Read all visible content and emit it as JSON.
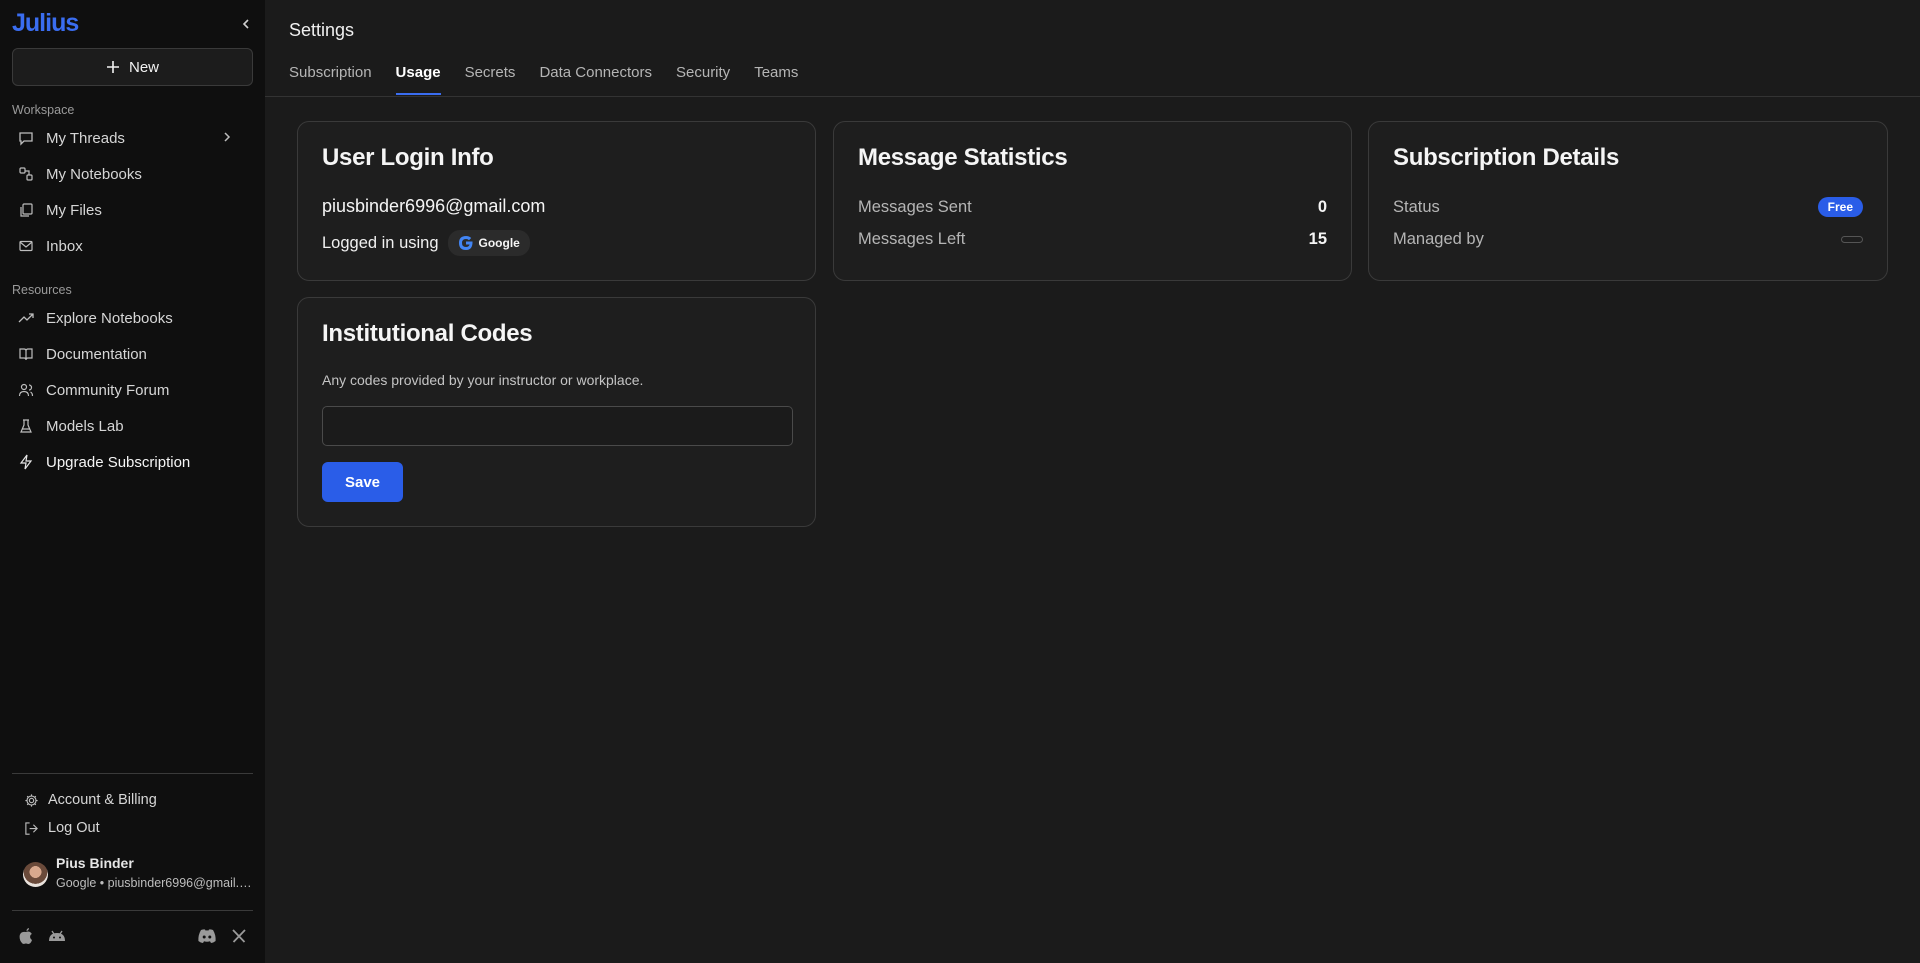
{
  "sidebar": {
    "logo": "Julius",
    "new_label": "New",
    "workspace_label": "Workspace",
    "workspace_items": [
      {
        "label": "My Threads",
        "icon": "chat-bubble-icon"
      },
      {
        "label": "My Notebooks",
        "icon": "notebook-nodes-icon"
      },
      {
        "label": "My Files",
        "icon": "files-icon"
      },
      {
        "label": "Inbox",
        "icon": "mail-icon"
      }
    ],
    "resources_label": "Resources",
    "resource_items": [
      {
        "label": "Explore Notebooks",
        "icon": "trending-icon"
      },
      {
        "label": "Documentation",
        "icon": "book-icon"
      },
      {
        "label": "Community Forum",
        "icon": "users-icon"
      },
      {
        "label": "Models Lab",
        "icon": "flask-icon"
      },
      {
        "label": "Upgrade Subscription",
        "icon": "lightning-icon"
      }
    ],
    "account_label": "Account & Billing",
    "logout_label": "Log Out",
    "user_name": "Pius Binder",
    "user_sub": "Google • piusbinder6996@gmail.com"
  },
  "main": {
    "title": "Settings",
    "tabs": [
      "Subscription",
      "Usage",
      "Secrets",
      "Data Connectors",
      "Security",
      "Teams"
    ],
    "active_tab": "Usage"
  },
  "login_card": {
    "title": "User Login Info",
    "email": "piusbinder6996@gmail.com",
    "logged_in_label": "Logged in using",
    "provider": "Google"
  },
  "stats_card": {
    "title": "Message Statistics",
    "sent_label": "Messages Sent",
    "sent_value": "0",
    "left_label": "Messages Left",
    "left_value": "15"
  },
  "subscription_card": {
    "title": "Subscription Details",
    "status_label": "Status",
    "status_value": "Free",
    "managed_label": "Managed by"
  },
  "codes_card": {
    "title": "Institutional Codes",
    "description": "Any codes provided by your instructor or workplace.",
    "input_value": "",
    "save_label": "Save"
  },
  "colors": {
    "accent": "#2a5de8",
    "sidebar_bg": "#0f0f0f",
    "main_bg": "#1b1b1b"
  }
}
